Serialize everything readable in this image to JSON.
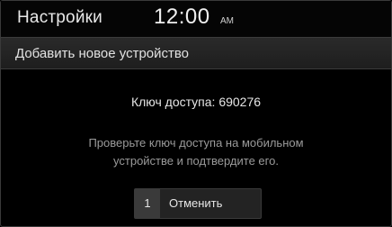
{
  "status_bar": {
    "title": "Настройки",
    "time": "12:00",
    "ampm": "AM"
  },
  "header": {
    "title": "Добавить новое устройство"
  },
  "access_key": {
    "text": "Ключ доступа: 690276"
  },
  "message": {
    "line1": "Проверьте ключ доступа на мобильном",
    "line2": "устройстве и подтвердите его."
  },
  "cancel_button": {
    "number": "1",
    "label": "Отменить"
  }
}
